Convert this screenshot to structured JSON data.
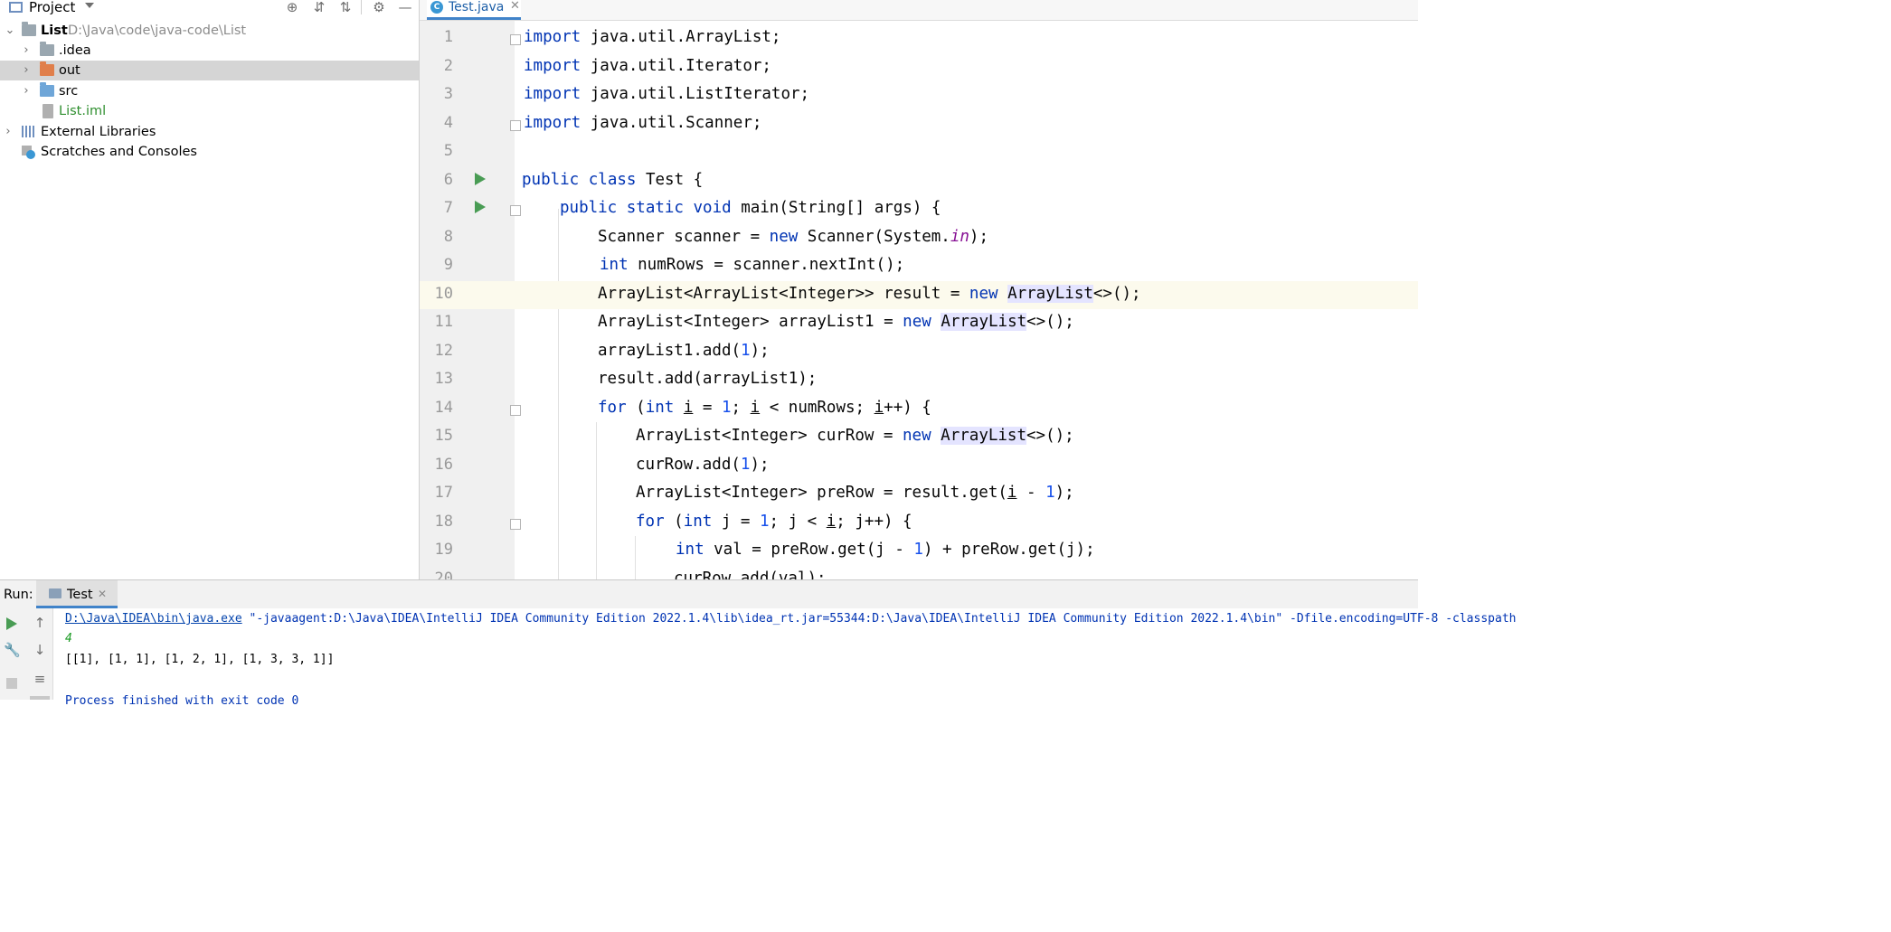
{
  "project": {
    "title": "Project",
    "tree": [
      {
        "label": "List",
        "hint": "D:\\Java\\code\\java-code\\List"
      },
      {
        "label": ".idea"
      },
      {
        "label": "out"
      },
      {
        "label": "src"
      },
      {
        "label": "List.iml"
      },
      {
        "label": "External Libraries"
      },
      {
        "label": "Scratches and Consoles"
      }
    ]
  },
  "editor": {
    "tab_label": "Test.java",
    "current_line": 10,
    "lines": [
      "1",
      "2",
      "3",
      "4",
      "5",
      "6",
      "7",
      "8",
      "9",
      "10",
      "11",
      "12",
      "13",
      "14",
      "15",
      "16",
      "17",
      "18",
      "19",
      "20"
    ],
    "code": {
      "l1_kw": "import",
      "l1_rest": " java.util.ArrayList;",
      "l2_kw": "import",
      "l2_rest": " java.util.Iterator;",
      "l3_kw": "import",
      "l3_rest": " java.util.ListIterator;",
      "l4_kw": "import",
      "l4_rest": " java.util.Scanner;",
      "l6_kw": "public class",
      "l6_rest": " Test {",
      "l7_kw": "public static void",
      "l7_rest": " main(String[] args) {",
      "l8_a": "Scanner scanner = ",
      "l8_kw": "new",
      "l8_b": " Scanner(System.",
      "l8_field": "in",
      "l8_c": ");",
      "l9_kw": "int",
      "l9_rest": " numRows = scanner.nextInt();",
      "l10_a": "ArrayList<ArrayList<Integer>> result = ",
      "l10_kw": "new",
      "l10_sp": " ",
      "l10_hl": "ArrayList",
      "l10_c": "<>();",
      "l11_a": "ArrayList<Integer> arrayList1 = ",
      "l11_kw": "new",
      "l11_sp": " ",
      "l11_hl": "ArrayList",
      "l11_c": "<>();",
      "l12_a": "arrayList1.add(",
      "l12_num": "1",
      "l12_c": ");",
      "l13": "result.add(arrayList1);",
      "l14_kw1": "for",
      "l14_a": " (",
      "l14_kw2": "int",
      "l14_sp": " ",
      "l14_i1": "i",
      "l14_b": " = ",
      "l14_num": "1",
      "l14_c": "; ",
      "l14_i2": "i",
      "l14_d": " < numRows; ",
      "l14_i3": "i",
      "l14_e": "++) {",
      "l15_a": "ArrayList<Integer> curRow = ",
      "l15_kw": "new",
      "l15_sp": " ",
      "l15_hl": "ArrayList",
      "l15_c": "<>();",
      "l16_a": "curRow.add(",
      "l16_num": "1",
      "l16_c": ");",
      "l17_a": "ArrayList<Integer> preRow = result.get(",
      "l17_i": "i",
      "l17_b": " - ",
      "l17_num": "1",
      "l17_c": ");",
      "l18_kw1": "for",
      "l18_a": " (",
      "l18_kw2": "int",
      "l18_b": " j = ",
      "l18_num": "1",
      "l18_c": "; j < ",
      "l18_i": "i",
      "l18_d": "; j++) {",
      "l19_kw": "int",
      "l19_a": " val = preRow.get(j - ",
      "l19_num": "1",
      "l19_b": ") + preRow.get(j);",
      "l20": "curRow.add(val);"
    }
  },
  "run": {
    "label": "Run:",
    "tab_label": "Test",
    "console": {
      "cmd_path": "D:\\Java\\IDEA\\bin\\java.exe",
      "cmd_rest": " \"-javaagent:D:\\Java\\IDEA\\IntelliJ IDEA Community Edition 2022.1.4\\lib\\idea_rt.jar=55344:D:\\Java\\IDEA\\IntelliJ IDEA Community Edition 2022.1.4\\bin\" -Dfile.encoding=UTF-8 -classpath",
      "input": "4",
      "output": "[[1], [1, 1], [1, 2, 1], [1, 3, 3, 1]]",
      "exit": "Process finished with exit code 0"
    }
  },
  "colors": {
    "keyword": "#0033b3",
    "number": "#1750eb",
    "field": "#871094",
    "run_green": "#499c54",
    "selection": "#d5d5d5",
    "current_line": "#fcfaed"
  }
}
